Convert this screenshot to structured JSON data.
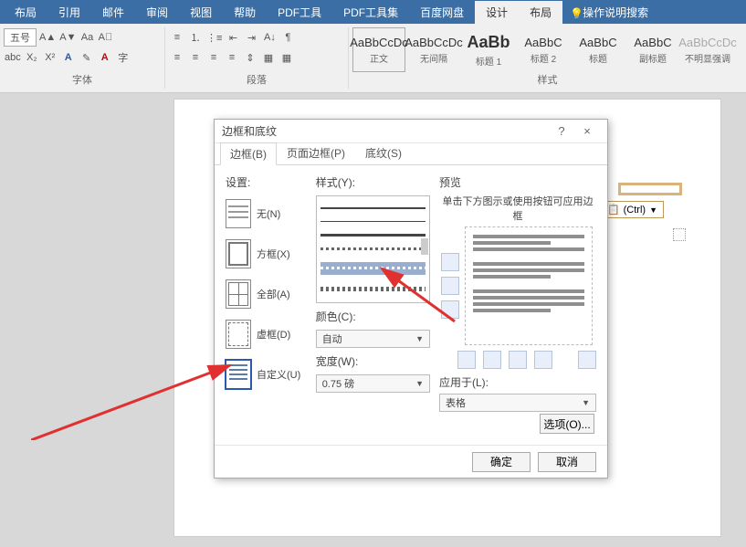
{
  "ribbon": {
    "tabs": [
      "布局",
      "引用",
      "邮件",
      "审阅",
      "视图",
      "帮助",
      "PDF工具",
      "PDF工具集",
      "百度网盘",
      "设计",
      "布局"
    ],
    "active_tab_indices": [
      9,
      10
    ],
    "help_search": "操作说明搜索",
    "font_group": "字体",
    "para_group": "段落",
    "styles_group": "样式",
    "font_size": "五号",
    "styles": [
      {
        "sample": "AaBbCcDc",
        "name": "正文"
      },
      {
        "sample": "AaBbCcDc",
        "name": "无间隔"
      },
      {
        "sample": "AaBb",
        "name": "标题 1"
      },
      {
        "sample": "AaBbC",
        "name": "标题 2"
      },
      {
        "sample": "AaBbC",
        "name": "标题"
      },
      {
        "sample": "AaBbC",
        "name": "副标题"
      },
      {
        "sample": "AaBbCcDc",
        "name": "不明显强调"
      }
    ]
  },
  "smart_tag": "(Ctrl)",
  "dialog": {
    "title": "边框和底纹",
    "help": "?",
    "close": "×",
    "tabs": [
      "边框(B)",
      "页面边框(P)",
      "底纹(S)"
    ],
    "active_tab": 0,
    "setting_label": "设置:",
    "settings": [
      {
        "label": "无(N)"
      },
      {
        "label": "方框(X)"
      },
      {
        "label": "全部(A)"
      },
      {
        "label": "虚框(D)"
      },
      {
        "label": "自定义(U)"
      }
    ],
    "selected_setting": 4,
    "style_label": "样式(Y):",
    "color_label": "颜色(C):",
    "color_value": "自动",
    "width_label": "宽度(W):",
    "width_value": "0.75 磅",
    "preview_label": "预览",
    "preview_hint": "单击下方图示或使用按钮可应用边框",
    "apply_label": "应用于(L):",
    "apply_value": "表格",
    "options_btn": "选项(O)...",
    "ok": "确定",
    "cancel": "取消"
  }
}
